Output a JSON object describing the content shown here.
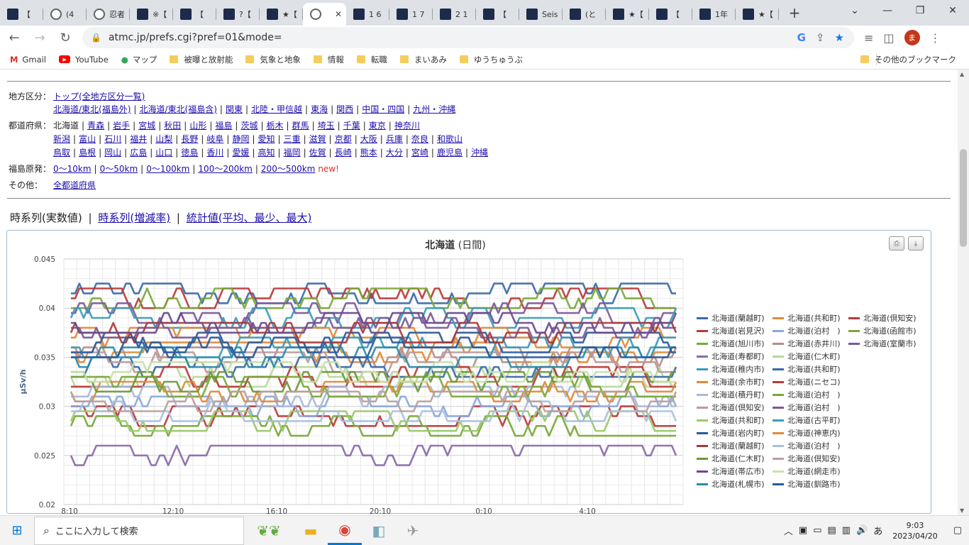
{
  "browser": {
    "tabs": [
      {
        "label": "【",
        "icon": "site-favicon"
      },
      {
        "label": "(4",
        "icon": "globe-icon"
      },
      {
        "label": "忍者",
        "icon": "globe-icon"
      },
      {
        "label": "※【",
        "icon": "site-favicon"
      },
      {
        "label": "【",
        "icon": "site-favicon"
      },
      {
        "label": "?【",
        "icon": "site-favicon"
      },
      {
        "label": "★【",
        "icon": "site-favicon"
      },
      {
        "label": "",
        "icon": "globe-icon",
        "active": true
      },
      {
        "label": "1 6",
        "icon": "site-favicon"
      },
      {
        "label": "1 7",
        "icon": "site-favicon"
      },
      {
        "label": "2 1",
        "icon": "site-favicon"
      },
      {
        "label": "【",
        "icon": "site-favicon"
      },
      {
        "label": "Seis",
        "icon": "site-favicon"
      },
      {
        "label": "(と",
        "icon": "site-favicon"
      },
      {
        "label": "★【",
        "icon": "site-favicon"
      },
      {
        "label": "【",
        "icon": "site-favicon"
      },
      {
        "label": "1年",
        "icon": "site-favicon"
      },
      {
        "label": "★【",
        "icon": "site-favicon"
      }
    ],
    "url": "atmc.jp/prefs.cgi?pref=01&mode=",
    "profile_initial": "ま",
    "bookmarks": [
      "Gmail",
      "YouTube",
      "マップ",
      "被曝と放射能",
      "気象と地象",
      "情報",
      "転職",
      "まいあみ",
      "ゆうちゅうぶ"
    ],
    "other_bookmarks": "その他のブックマーク"
  },
  "nav": {
    "region_label": "地方区分：",
    "region_top": "トップ(全地方区分一覧)",
    "regions": [
      "北海道/東北(福島外)",
      "北海道/東北(福島含)",
      "関東",
      "北陸・甲信越",
      "東海",
      "関西",
      "中国・四国",
      "九州・沖縄"
    ],
    "pref_label": "都道府県：",
    "prefs_row1": [
      "北海道",
      "青森",
      "岩手",
      "宮城",
      "秋田",
      "山形",
      "福島",
      "茨城",
      "栃木",
      "群馬",
      "埼玉",
      "千葉",
      "東京",
      "神奈川"
    ],
    "prefs_row2": [
      "新潟",
      "富山",
      "石川",
      "福井",
      "山梨",
      "長野",
      "岐阜",
      "静岡",
      "愛知",
      "三重",
      "滋賀",
      "京都",
      "大阪",
      "兵庫",
      "奈良",
      "和歌山"
    ],
    "prefs_row3": [
      "鳥取",
      "島根",
      "岡山",
      "広島",
      "山口",
      "徳島",
      "香川",
      "愛媛",
      "高知",
      "福岡",
      "佐賀",
      "長崎",
      "熊本",
      "大分",
      "宮崎",
      "鹿児島",
      "沖縄"
    ],
    "fukushima_label": "福島原発：",
    "fukushima": [
      "0〜10km",
      "0〜50km",
      "0〜100km",
      "100〜200km",
      "200〜500km"
    ],
    "new_label": "new!",
    "other_label": "その他：",
    "other_link": "全都道府県"
  },
  "views": {
    "current": "時系列(実数値)",
    "link1": "時系列(増減率)",
    "link2": "統計値(平均、最少、最大)",
    "sep": "|"
  },
  "chart_data": {
    "type": "line",
    "title": "北海道",
    "subtitle": "(日間)",
    "ylabel": "μSv/h",
    "ylim": [
      0.02,
      0.045
    ],
    "yticks": [
      "0.02",
      "0.025",
      "0.03",
      "0.035",
      "0.04",
      "0.045"
    ],
    "xticks": [
      "8:10",
      "12:10",
      "16:10",
      "20:10",
      "0:10",
      "4:10"
    ],
    "grid": true,
    "legend_position": "right",
    "series": [
      {
        "name": "北海道(蘭越町)",
        "color": "#3a6aa8",
        "base": 0.0415
      },
      {
        "name": "北海道(共和町)",
        "color": "#e08a3a",
        "base": 0.0355
      },
      {
        "name": "北海道(倶知安)",
        "color": "#b83a3a",
        "base": 0.041
      },
      {
        "name": "北海道(岩見沢)",
        "color": "#b83a3a",
        "base": 0.029
      },
      {
        "name": "北海道(泊村　)",
        "color": "#8aa8d8",
        "base": 0.03
      },
      {
        "name": "北海道(函館市)",
        "color": "#7aa83a",
        "base": 0.041
      },
      {
        "name": "北海道(旭川市)",
        "color": "#7aa83a",
        "base": 0.028
      },
      {
        "name": "北海道(赤井川)",
        "color": "#b88a8a",
        "base": 0.035
      },
      {
        "name": "北海道(室蘭市)",
        "color": "#7a5a9a",
        "base": 0.0395
      },
      {
        "name": "北海道(寿都町)",
        "color": "#8a6aaa",
        "base": 0.025
      },
      {
        "name": "北海道(仁木町)",
        "color": "#b8d89a",
        "base": 0.033
      },
      {
        "name": "北海道(稚内市)",
        "color": "#3a9ab8",
        "base": 0.039
      },
      {
        "name": "北海道(共和町)",
        "color": "#3a6aa8",
        "base": 0.034
      },
      {
        "name": "北海道(余市町)",
        "color": "#e08a3a",
        "base": 0.037
      },
      {
        "name": "北海道(ニセコ)",
        "color": "#b83a3a",
        "base": 0.033
      },
      {
        "name": "北海道(積丹町)",
        "color": "#a8b8d8",
        "base": 0.031
      },
      {
        "name": "北海道(泊村　)",
        "color": "#7aa83a",
        "base": 0.032
      },
      {
        "name": "北海道(倶知安)",
        "color": "#b89a9a",
        "base": 0.0345
      },
      {
        "name": "北海道(泊村　)",
        "color": "#7a5a9a",
        "base": 0.038
      },
      {
        "name": "北海道(共和町)",
        "color": "#9ac86a",
        "base": 0.0285
      },
      {
        "name": "北海道(古平町)",
        "color": "#3a9ab8",
        "base": 0.036
      },
      {
        "name": "北海道(岩内町)",
        "color": "#2a5a9a",
        "base": 0.0365
      },
      {
        "name": "北海道(神恵内)",
        "color": "#e08a3a",
        "base": 0.0315
      },
      {
        "name": "北海道(蘭越町)",
        "color": "#a83a3a",
        "base": 0.0375
      },
      {
        "name": "北海道(泊村　)",
        "color": "#a8c0e0",
        "base": 0.0295
      },
      {
        "name": "北海道(仁木町)",
        "color": "#6a983a",
        "base": 0.0325
      },
      {
        "name": "北海道(倶知安)",
        "color": "#b8a0a0",
        "base": 0.0305
      },
      {
        "name": "北海道(帯広市)",
        "color": "#6a4a8a",
        "base": 0.0385
      },
      {
        "name": "北海道(網走市)",
        "color": "#c8e0aa",
        "base": 0.0335
      },
      {
        "name": "北海道(札幌市)",
        "color": "#2a8aa8",
        "base": 0.035
      },
      {
        "name": "北海道(釧路市)",
        "color": "#2a5a9a",
        "base": 0.036
      }
    ],
    "legend_columns": 3
  },
  "taskbar": {
    "search_placeholder": "ここに入力して検索",
    "time": "9:03",
    "date": "2023/04/20",
    "ime": "あ"
  }
}
